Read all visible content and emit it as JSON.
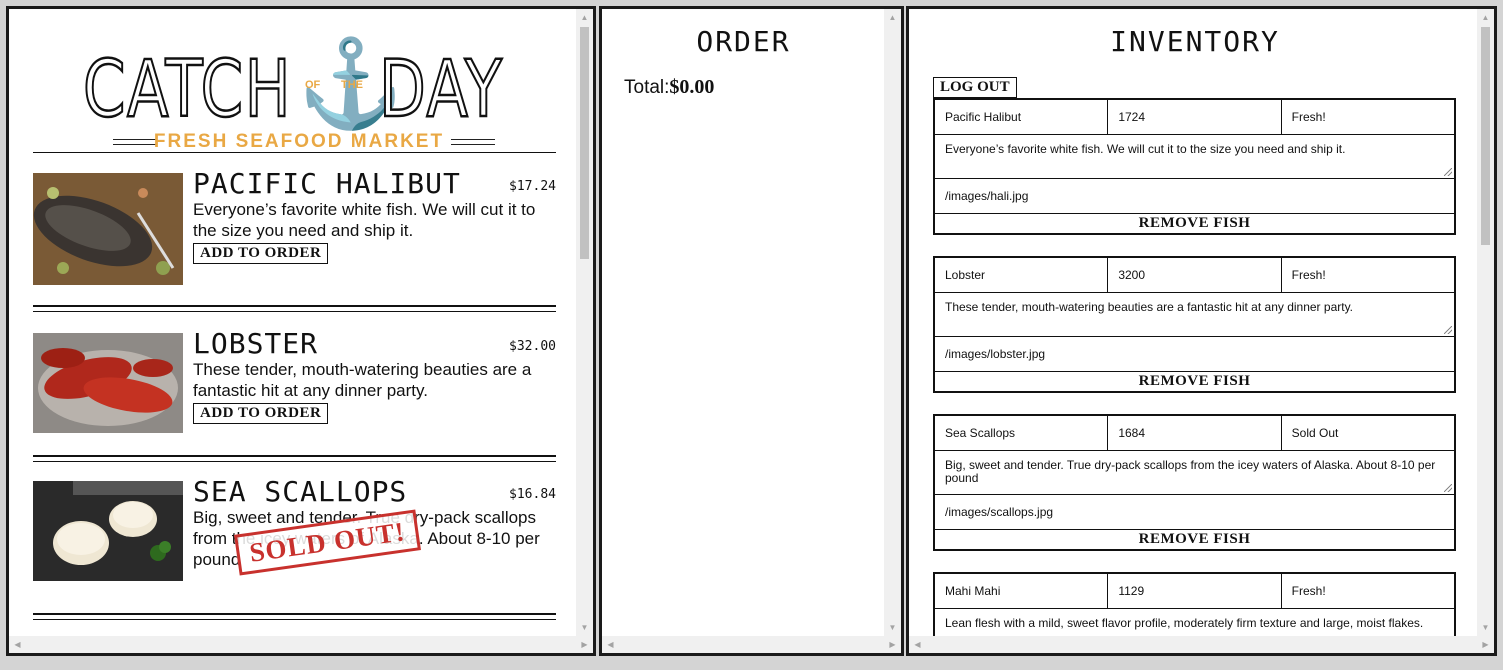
{
  "menu": {
    "logo": {
      "word1": "CATCH",
      "of": "OF",
      "the": "THE",
      "word2": "DAY",
      "tagline": "FRESH SEAFOOD MARKET"
    },
    "items": [
      {
        "name": "Pacific Halibut",
        "price": "$17.24",
        "desc": "Everyone’s favorite white fish. We will cut it to the size you need and ship it.",
        "button": "ADD TO ORDER"
      },
      {
        "name": "Lobster",
        "price": "$32.00",
        "desc": "These tender, mouth-watering beauties are a fantastic hit at any dinner party.",
        "button": "ADD TO ORDER"
      },
      {
        "name": "Sea Scallops",
        "price": "$16.84",
        "desc": "Big, sweet and tender. True dry-pack scallops from the icey waters of Alaska. About 8-10 per pound",
        "sold_out": "SOLD OUT!"
      }
    ]
  },
  "order": {
    "title": "ORDER",
    "total_label": "Total:",
    "total_value": "$0.00"
  },
  "inventory": {
    "title": "INVENTORY",
    "logout": "LOG OUT",
    "remove_label": "REMOVE FISH",
    "items": [
      {
        "name": "Pacific Halibut",
        "price": "1724",
        "status": "Fresh!",
        "desc": "Everyone’s favorite white fish. We will cut it to the size you need and ship it.",
        "image": "/images/hali.jpg"
      },
      {
        "name": "Lobster",
        "price": "3200",
        "status": "Fresh!",
        "desc": "These tender, mouth-watering beauties are a fantastic hit at any dinner party.",
        "image": "/images/lobster.jpg"
      },
      {
        "name": "Sea Scallops",
        "price": "1684",
        "status": "Sold Out",
        "desc": "Big, sweet and tender. True dry-pack scallops from the icey waters of Alaska. About 8-10 per pound",
        "image": "/images/scallops.jpg"
      },
      {
        "name": "Mahi Mahi",
        "price": "1129",
        "status": "Fresh!",
        "desc": "Lean flesh with a mild, sweet flavor profile, moderately firm texture and large, moist flakes."
      }
    ]
  },
  "icons": [
    "anchor-icon",
    "scroll-up-icon",
    "scroll-down-icon",
    "scroll-left-icon",
    "scroll-right-icon"
  ]
}
